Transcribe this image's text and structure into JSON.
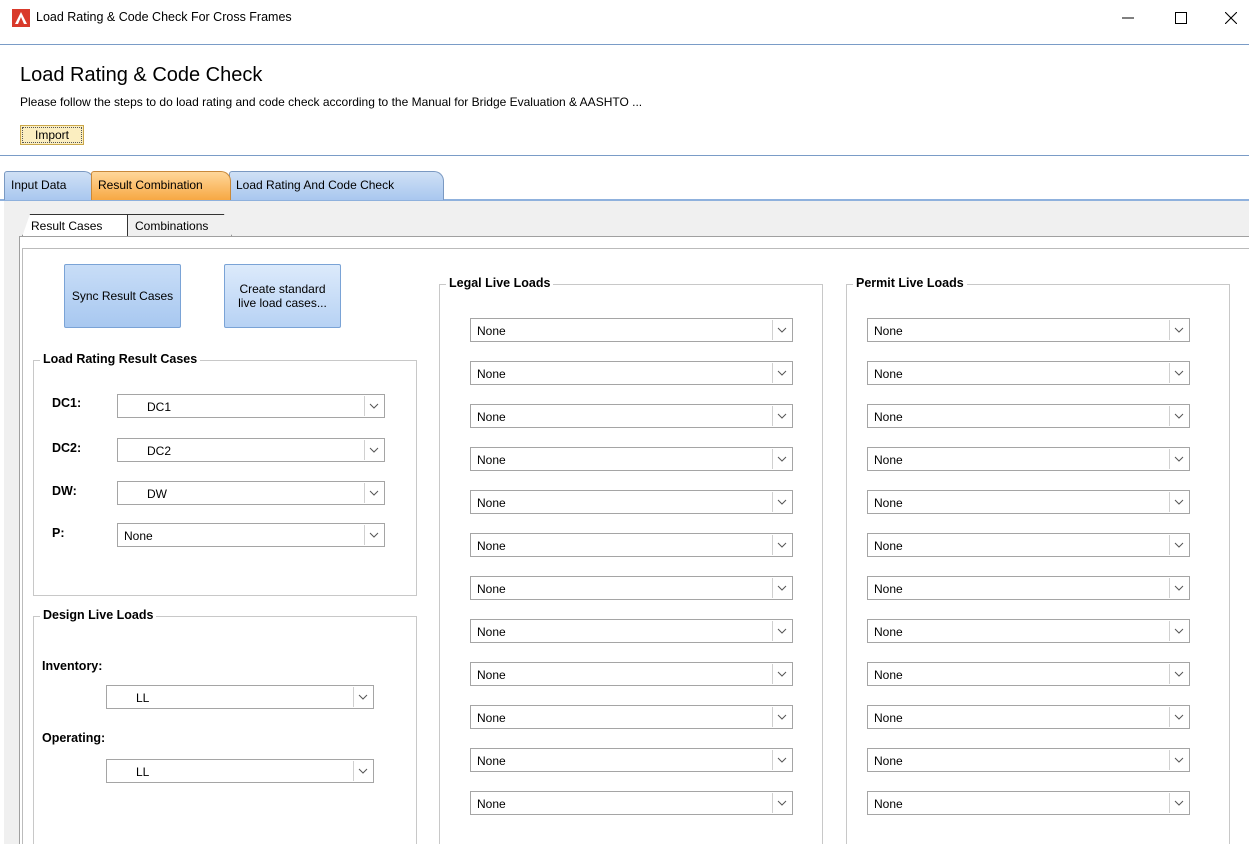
{
  "window": {
    "title": "Load Rating & Code Check For Cross Frames",
    "controls": {
      "minimize": "—",
      "maximize": "☐",
      "close": "✕"
    }
  },
  "header": {
    "title": "Load Rating & Code Check",
    "description": "Please follow the steps to do load rating and code check according to the Manual for Bridge Evaluation & AASHTO  ...",
    "import_label": "Import"
  },
  "main_tabs": [
    "Input Data",
    "Result Combination",
    "Load Rating And Code Check"
  ],
  "sub_tabs": [
    "Result Cases",
    "Combinations"
  ],
  "buttons": {
    "sync": "Sync Result Cases",
    "create": "Create standard live load cases..."
  },
  "load_rating_result_cases": {
    "title": "Load Rating Result Cases",
    "rows": [
      {
        "label": "DC1:",
        "value": "DC1"
      },
      {
        "label": "DC2:",
        "value": "DC2"
      },
      {
        "label": "DW:",
        "value": "DW"
      },
      {
        "label": "P:",
        "value": "None"
      }
    ]
  },
  "design_live_loads": {
    "title": "Design Live Loads",
    "inventory_label": "Inventory:",
    "inventory_value": "LL",
    "operating_label": "Operating:",
    "operating_value": "LL"
  },
  "legal_live_loads": {
    "title": "Legal Live Loads",
    "values": [
      "None",
      "None",
      "None",
      "None",
      "None",
      "None",
      "None",
      "None",
      "None",
      "None",
      "None",
      "None"
    ]
  },
  "permit_live_loads": {
    "title": "Permit Live Loads",
    "values": [
      "None",
      "None",
      "None",
      "None",
      "None",
      "None",
      "None",
      "None",
      "None",
      "None",
      "None",
      "None"
    ]
  },
  "colors": {
    "accent_line": "#7a9cc7",
    "active_tab": "#f7a843",
    "inactive_tab": "#a9c7ef",
    "import_button": "#fbeec0"
  }
}
